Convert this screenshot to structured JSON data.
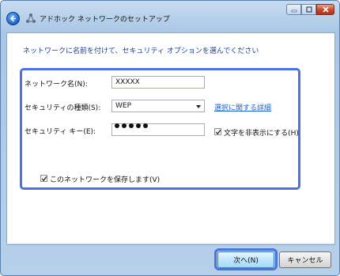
{
  "window": {
    "title": "アドホック ネットワークのセットアップ",
    "controls": [
      "minimize",
      "maximize",
      "close"
    ]
  },
  "instruction": "ネットワークに名前を付けて、セキュリティ オプションを選んでください",
  "form": {
    "network_name": {
      "label": "ネットワーク名(N):",
      "value": "XXXXX"
    },
    "security_type": {
      "label": "セキュリティの種類(S):",
      "value": "WEP"
    },
    "security_link": "選択に関する詳細",
    "security_key": {
      "label": "セキュリティ キー(E):",
      "masked_length": 5
    },
    "hide_chars": {
      "label": "文字を非表示にする(H)",
      "checked": true
    },
    "save_network": {
      "label": "このネットワークを保存します(V)",
      "checked": true
    }
  },
  "buttons": {
    "next": "次へ(N)",
    "cancel": "キャンセル"
  },
  "colors": {
    "highlight": "#4a72e0",
    "link": "#1b5fc8",
    "instruction": "#1e3f8a"
  }
}
